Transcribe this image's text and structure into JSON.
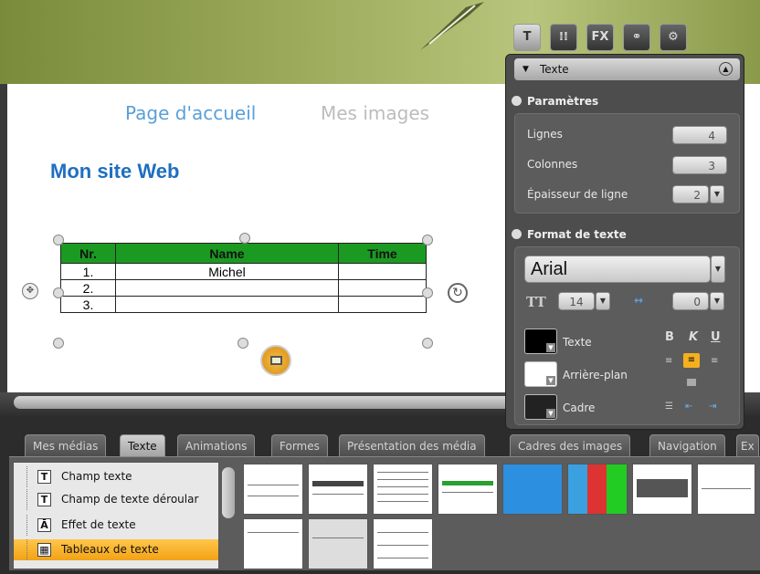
{
  "website": {
    "nav": [
      "Page d'accueil",
      "Mes images"
    ],
    "title": "Mon site Web",
    "table": {
      "headers": [
        "Nr.",
        "Name",
        "Time"
      ],
      "rows": [
        [
          "1.",
          "Michel",
          ""
        ],
        [
          "2.",
          "",
          ""
        ],
        [
          "3.",
          "",
          ""
        ]
      ]
    }
  },
  "bottom": {
    "tabs": [
      "Mes médias",
      "Texte",
      "Animations",
      "Formes",
      "Présentation des média",
      "Cadres des images",
      "Navigation",
      "Ex"
    ],
    "active_tab": "Texte",
    "library": [
      {
        "label": "Champ texte",
        "icon": "T"
      },
      {
        "label": "Champ de texte déroular",
        "icon": "T"
      },
      {
        "label": "Effet de texte",
        "icon": "Ā"
      },
      {
        "label": "Tableaux de texte",
        "icon": "▦"
      }
    ]
  },
  "panel": {
    "tabs": [
      "T",
      "⁞⁞",
      "FX",
      "⚭",
      "⚙"
    ],
    "header": "Texte",
    "params_title": "Paramètres",
    "rows_label": "Lignes",
    "rows_value": "4",
    "cols_label": "Colonnes",
    "cols_value": "3",
    "line_label": "Épaisseur de ligne",
    "line_value": "2",
    "format_title": "Format de texte",
    "font": "Arial",
    "size_value": "14",
    "spacing_value": "0",
    "text_label": "Texte",
    "bg_label": "Arrière-plan",
    "frame_label": "Cadre",
    "bold": "B",
    "italic": "K",
    "underline": "U",
    "colors": {
      "text": "#000000",
      "background": "#ffffff",
      "frame": "#222222"
    }
  }
}
